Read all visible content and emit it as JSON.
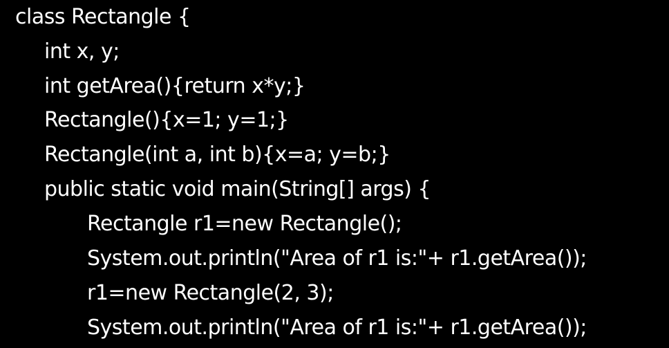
{
  "editor": {
    "background_color": "#000000",
    "text_color": "#ffffff",
    "lines": [
      {
        "text": "class Rectangle {",
        "indent": 0
      },
      {
        "text": "int x, y;",
        "indent": 1
      },
      {
        "text": "int getArea(){return x*y;}",
        "indent": 1
      },
      {
        "text": "Rectangle(){x=1; y=1;}",
        "indent": 1
      },
      {
        "text": "Rectangle(int a, int b){x=a; y=b;}",
        "indent": 1
      },
      {
        "text": "public static void main(String[] args) {",
        "indent": 1
      },
      {
        "text": "Rectangle r1=new Rectangle();",
        "indent": 2
      },
      {
        "text": "System.out.println(\"Area of r1 is:\"+ r1.getArea());",
        "indent": 2
      },
      {
        "text": "r1=new Rectangle(2, 3);",
        "indent": 2
      },
      {
        "text": "System.out.println(\"Area of r1 is:\"+ r1.getArea());",
        "indent": 2
      }
    ]
  }
}
